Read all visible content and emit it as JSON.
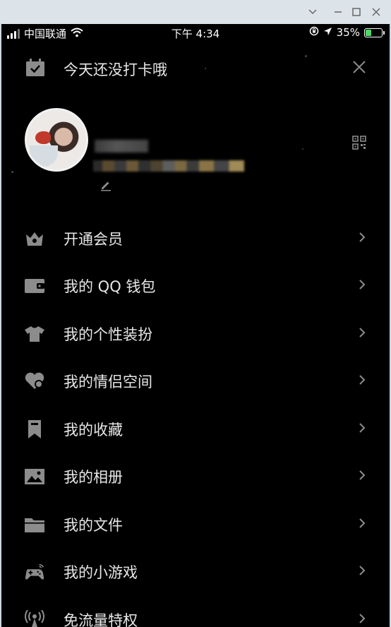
{
  "statusbar": {
    "carrier": "中国联通",
    "time": "下午 4:34",
    "battery": "35%",
    "battery_level": 0.35
  },
  "checkin": {
    "text": "今天还没打卡哦"
  },
  "menu": {
    "items": [
      {
        "label": "开通会员",
        "icon": "crown-icon"
      },
      {
        "label": "我的 QQ 钱包",
        "icon": "wallet-icon"
      },
      {
        "label": "我的个性装扮",
        "icon": "tshirt-icon"
      },
      {
        "label": "我的情侣空间",
        "icon": "heart-icon"
      },
      {
        "label": "我的收藏",
        "icon": "bookmark-icon"
      },
      {
        "label": "我的相册",
        "icon": "photo-icon"
      },
      {
        "label": "我的文件",
        "icon": "folder-icon"
      },
      {
        "label": "我的小游戏",
        "icon": "gamepad-icon"
      },
      {
        "label": "免流量特权",
        "icon": "antenna-icon"
      }
    ]
  },
  "colors": {
    "background": "#000000",
    "text": "#e8e8e8",
    "icon": "#8c8c8c",
    "battery_fill": "#4cd964"
  }
}
